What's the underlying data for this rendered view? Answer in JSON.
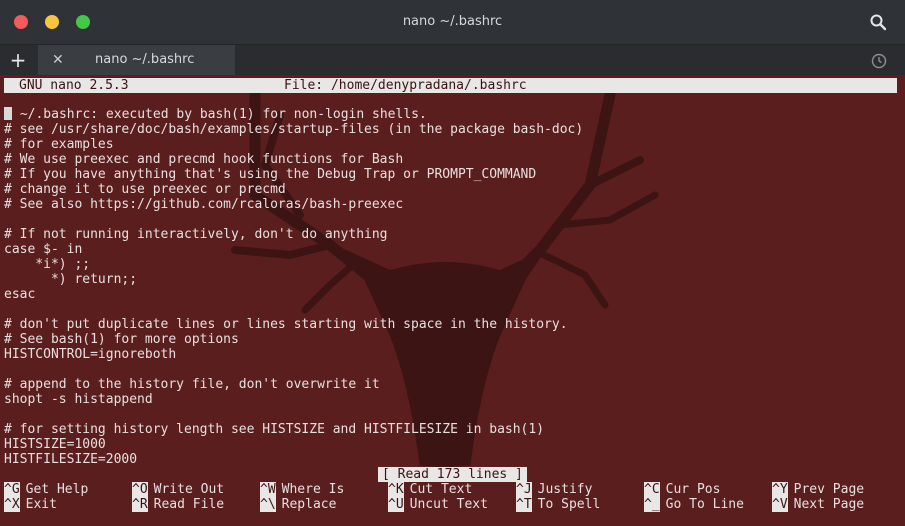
{
  "window": {
    "title": "nano ~/.bashrc"
  },
  "tabs": [
    {
      "label": "nano ~/.bashrc"
    }
  ],
  "icons": {
    "new_tab": "plus-icon",
    "close_tab": "close-icon",
    "search": "search-icon",
    "history": "clock-icon"
  },
  "colors": {
    "terminal_bg": "#5b1e1e",
    "highlight_bg": "#e9e6e6",
    "titlebar": "#2f3236"
  },
  "nano": {
    "version": "GNU nano 2.5.3",
    "file": "File: /home/denypradana/.bashrc",
    "status": "[ Read 173 lines ]"
  },
  "lines": [
    "~/.bashrc: executed by bash(1) for non-login shells.",
    "# see /usr/share/doc/bash/examples/startup-files (in the package bash-doc)",
    "# for examples",
    "# We use preexec and precmd hook functions for Bash",
    "# If you have anything that's using the Debug Trap or PROMPT_COMMAND",
    "# change it to use preexec or precmd",
    "# See also https://github.com/rcaloras/bash-preexec",
    "",
    "# If not running interactively, don't do anything",
    "case $- in",
    "    *i*) ;;",
    "      *) return;;",
    "esac",
    "",
    "# don't put duplicate lines or lines starting with space in the history.",
    "# See bash(1) for more options",
    "HISTCONTROL=ignoreboth",
    "",
    "# append to the history file, don't overwrite it",
    "shopt -s histappend",
    "",
    "# for setting history length see HISTSIZE and HISTFILESIZE in bash(1)",
    "HISTSIZE=1000",
    "HISTFILESIZE=2000"
  ],
  "shortcuts": [
    [
      {
        "key": "^G",
        "label": "Get Help"
      },
      {
        "key": "^O",
        "label": "Write Out"
      },
      {
        "key": "^W",
        "label": "Where Is"
      },
      {
        "key": "^K",
        "label": "Cut Text"
      },
      {
        "key": "^J",
        "label": "Justify"
      },
      {
        "key": "^C",
        "label": "Cur Pos"
      },
      {
        "key": "^Y",
        "label": "Prev Page"
      }
    ],
    [
      {
        "key": "^X",
        "label": "Exit"
      },
      {
        "key": "^R",
        "label": "Read File"
      },
      {
        "key": "^\\",
        "label": "Replace"
      },
      {
        "key": "^U",
        "label": "Uncut Text"
      },
      {
        "key": "^T",
        "label": "To Spell"
      },
      {
        "key": "^_",
        "label": "Go To Line"
      },
      {
        "key": "^V",
        "label": "Next Page"
      }
    ]
  ]
}
